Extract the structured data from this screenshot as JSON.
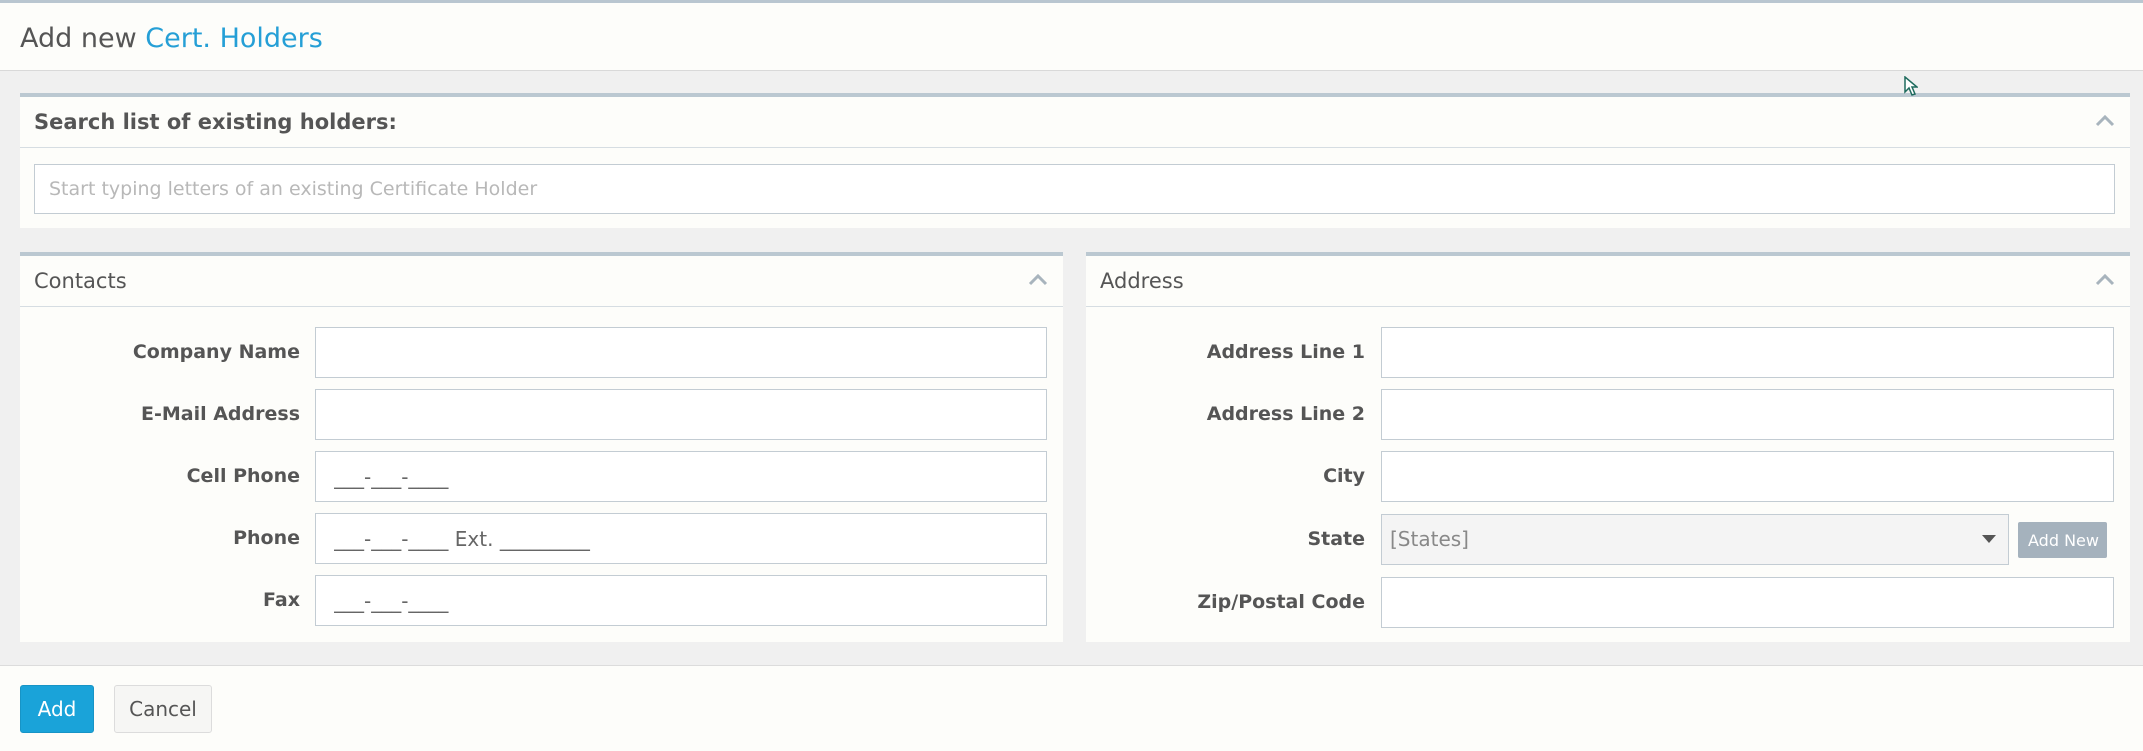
{
  "header": {
    "prefix": "Add new",
    "accent": "Cert. Holders"
  },
  "search_panel": {
    "title": "Search list of existing holders:",
    "placeholder": "Start typing letters of an existing Certificate Holder"
  },
  "contacts_panel": {
    "title": "Contacts",
    "fields": [
      {
        "label": "Company Name",
        "value": ""
      },
      {
        "label": "E-Mail Address",
        "value": ""
      },
      {
        "label": "Cell Phone",
        "placeholder": "___-___-____"
      },
      {
        "label": "Phone",
        "placeholder": "___-___-____ Ext. _________"
      },
      {
        "label": "Fax",
        "placeholder": "___-___-____"
      }
    ]
  },
  "address_panel": {
    "title": "Address",
    "fields": [
      {
        "label": "Address Line 1",
        "value": ""
      },
      {
        "label": "Address Line 2",
        "value": ""
      },
      {
        "label": "City",
        "value": ""
      },
      {
        "label": "State",
        "selected": "[States]",
        "add_new_label": "Add New"
      },
      {
        "label": "Zip/Postal Code",
        "value": ""
      }
    ]
  },
  "footer": {
    "add_label": "Add",
    "cancel_label": "Cancel"
  },
  "colors": {
    "accent": "#259fd6",
    "primary_button": "#1aa3d9",
    "panel_border": "#bbc8d1",
    "add_new_button": "#a5b2bd"
  },
  "icons": {
    "collapse": "chevron-up-icon",
    "select_caret": "caret-down-icon",
    "cursor": "mouse-pointer-icon"
  }
}
